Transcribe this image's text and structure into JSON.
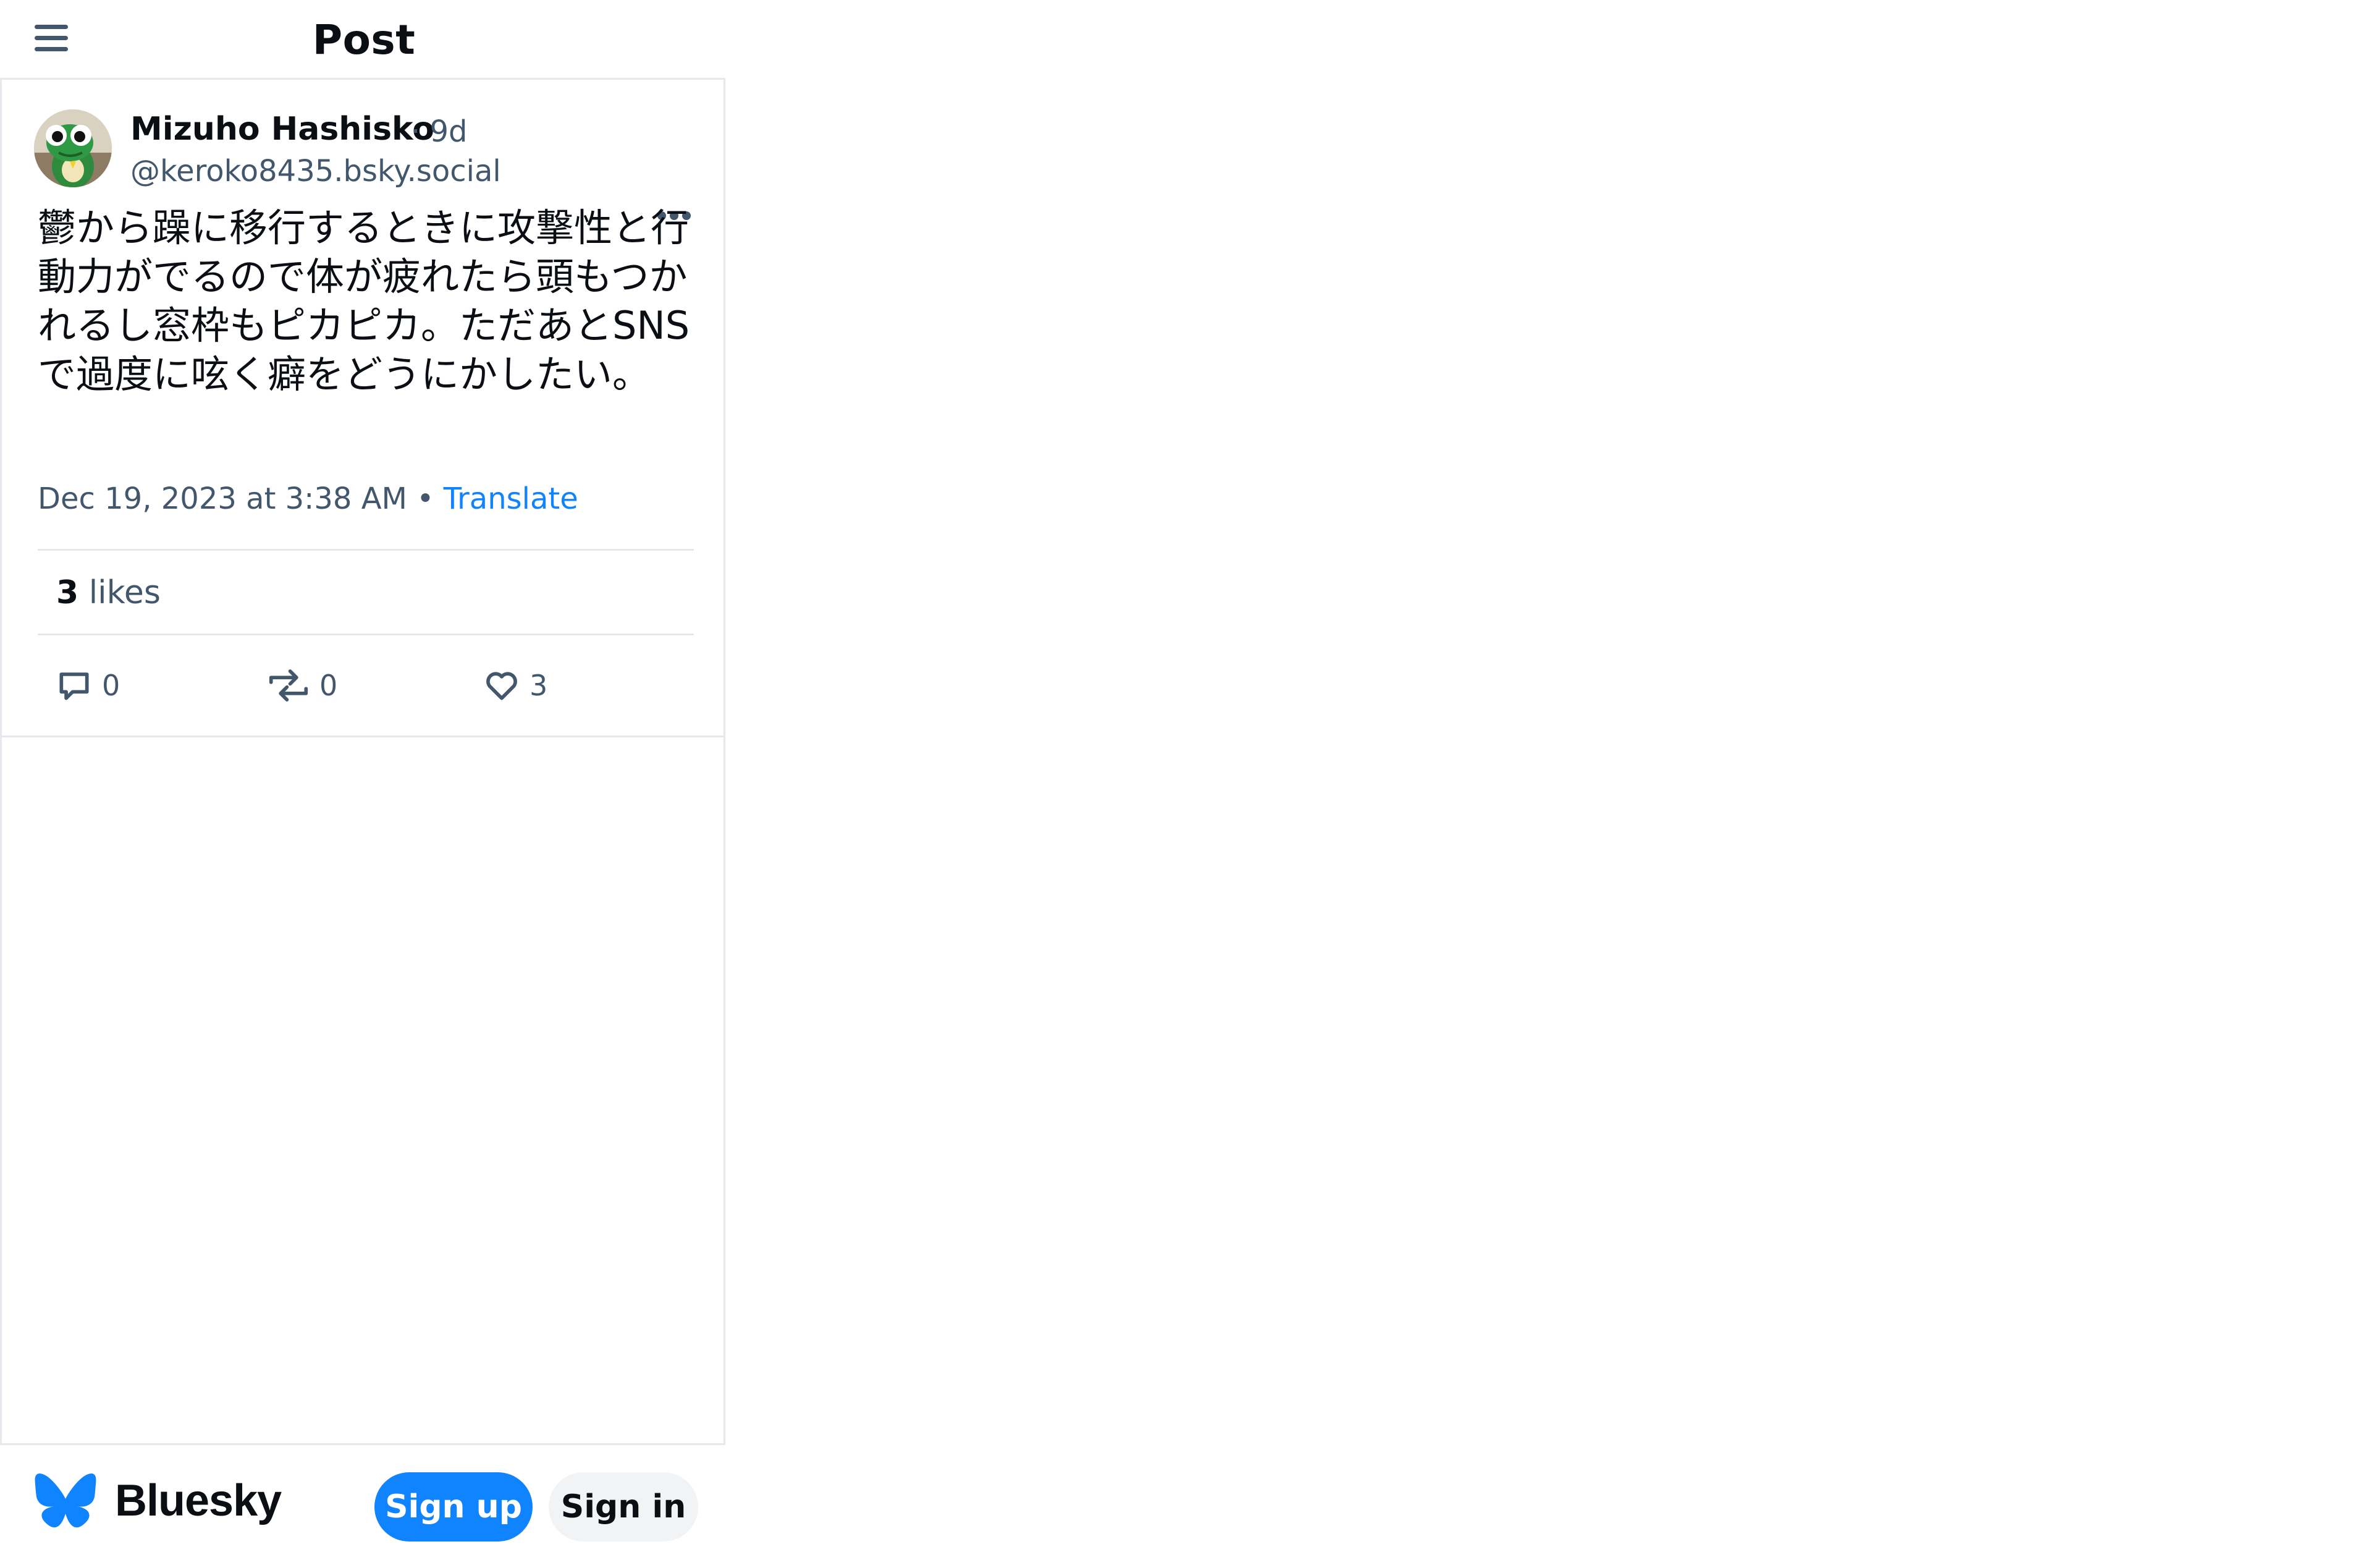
{
  "header": {
    "title": "Post",
    "menu_icon": "hamburger-menu-icon"
  },
  "post": {
    "author_name": "Mizuho Hashisko",
    "age": "· 9d",
    "handle": "@keroko8435.bsky.social",
    "text": "鬱から躁に移行するときに攻撃性と行動力がでるので体が疲れたら頭もつかれるし窓枠もピカピカ。ただあとSNSで過度に呟く癖をどうにかしたい。",
    "timestamp": "Dec 19, 2023 at 3:38 AM",
    "separator": "•",
    "translate_label": "Translate",
    "likes_count": "3",
    "likes_label": "likes",
    "actions": {
      "reply_count": "0",
      "repost_count": "0",
      "like_count": "3"
    },
    "more_icon": "ellipsis-icon"
  },
  "footer": {
    "brand": "Bluesky",
    "signup_label": "Sign up",
    "signin_label": "Sign in",
    "brand_color": "#1083fe"
  },
  "colors": {
    "accent": "#1083fe",
    "muted_text": "#42576c",
    "border": "#e5e9ed"
  }
}
